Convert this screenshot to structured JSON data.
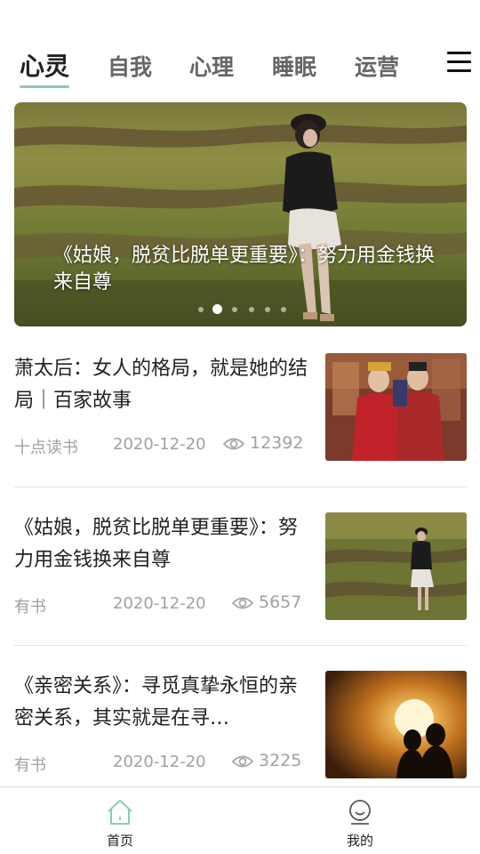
{
  "tabs": [
    {
      "label": "心灵",
      "active": true
    },
    {
      "label": "自我",
      "active": false
    },
    {
      "label": "心理",
      "active": false
    },
    {
      "label": "睡眠",
      "active": false
    },
    {
      "label": "运营",
      "active": false
    }
  ],
  "menu_icon": "hamburger-menu-icon",
  "banner": {
    "caption": "《姑娘，脱贫比脱单更重要》：努力用金钱换来自尊",
    "slide_count": 6,
    "active_slide": 2
  },
  "articles": [
    {
      "title": "萧太后：女人的格局，就是她的结局｜百家故事",
      "source": "十点读书",
      "date": "2020-12-20",
      "views": "12392",
      "thumb": "costume-drama-couple"
    },
    {
      "title": "《姑娘，脱贫比脱单更重要》：努力用金钱换来自尊",
      "source": "有书",
      "date": "2020-12-20",
      "views": "5657",
      "thumb": "woman-sitting-in-field"
    },
    {
      "title": "《亲密关系》：寻觅真挚永恒的亲密关系，其实就是在寻…",
      "source": "有书",
      "date": "2020-12-20",
      "views": "3225",
      "thumb": "sunset-couple-silhouette"
    }
  ],
  "bottom_nav": [
    {
      "label": "首页",
      "icon": "home-icon",
      "active": true
    },
    {
      "label": "我的",
      "icon": "profile-icon",
      "active": false
    }
  ],
  "colors": {
    "accent": "#8fc8bf",
    "text_primary": "#222222",
    "text_secondary": "#a0a0a0",
    "divider": "#e6e6e6"
  }
}
